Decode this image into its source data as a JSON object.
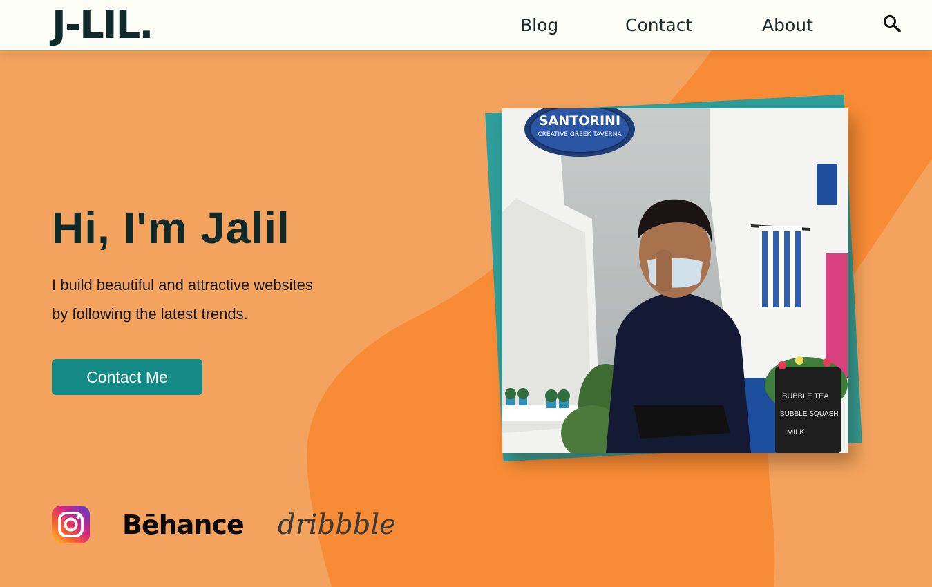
{
  "header": {
    "logo": "J-LIL.",
    "nav": {
      "blog": "Blog",
      "contact": "Contact",
      "about": "About"
    },
    "search_icon": "search-icon"
  },
  "hero": {
    "title": "Hi, I'm Jalil",
    "subtitle_line1": "I build beautiful and attractive websites",
    "subtitle_line2": "by following the latest trends.",
    "cta_label": "Contact Me"
  },
  "photo": {
    "sign_line1": "SANTORINI",
    "sign_line2": "CREATIVE GREEK TAVERNA",
    "board_line1": "BUBBLE TEA",
    "board_line2": "BUBBLE SQUASH",
    "board_line3": "MILK"
  },
  "social": {
    "instagram_icon": "instagram-icon",
    "behance_label": "Bēhance",
    "dribbble_label": "dribbble"
  },
  "colors": {
    "background": "#F3A35E",
    "blob": "#F88C36",
    "accent_teal": "#148A86",
    "photo_frame": "#2E9E9A",
    "header_bg": "#FDFDF7",
    "logo_text": "#0E2A2A"
  }
}
